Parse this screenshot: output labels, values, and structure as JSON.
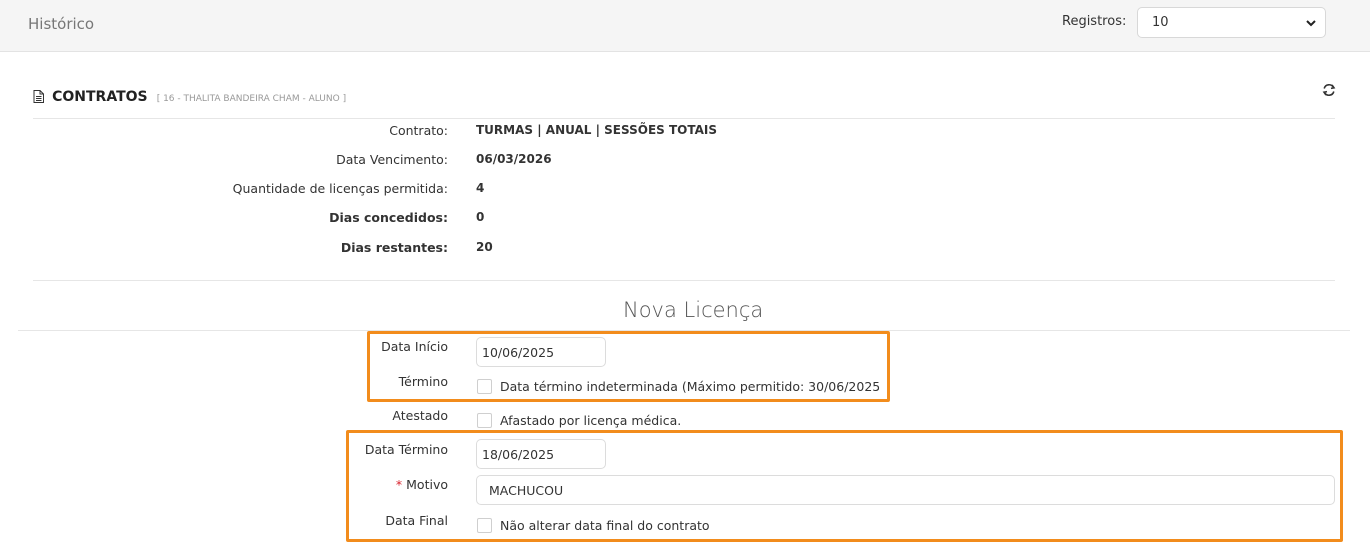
{
  "header": {
    "title": "Histórico",
    "records_label": "Registros:",
    "records_value": "10"
  },
  "contracts": {
    "title": "CONTRATOS",
    "subtitle": "[ 16 - THALITA BANDEIRA CHAM - ALUNO ]",
    "info": [
      {
        "label": "Contrato:",
        "value": "TURMAS | ANUAL | SESSÕES TOTAIS"
      },
      {
        "label": "Data Vencimento:",
        "value": "06/03/2026"
      },
      {
        "label": "Quantidade de licenças permitida:",
        "value": "4"
      },
      {
        "label": "Dias concedidos:",
        "value": "0"
      },
      {
        "label": "Dias restantes:",
        "value": "20"
      }
    ]
  },
  "form": {
    "title": "Nova Licença",
    "start_label": "Data Início",
    "start_value": "10/06/2025",
    "end_label": "Término",
    "end_checkbox_label": "Data término indeterminada (Máximo permitido: 30/06/2025",
    "certificate_label": "Atestado",
    "certificate_checkbox_label": "Afastado por licença médica.",
    "end_date_label": "Data Término",
    "end_date_value": "18/06/2025",
    "reason_required_mark": "*",
    "reason_label": "Motivo",
    "reason_value": "MACHUCOU",
    "final_date_label": "Data Final",
    "final_date_checkbox_label": "Não alterar data final do contrato"
  },
  "colors": {
    "highlight": "#f28c1c",
    "required": "#d9232d"
  }
}
